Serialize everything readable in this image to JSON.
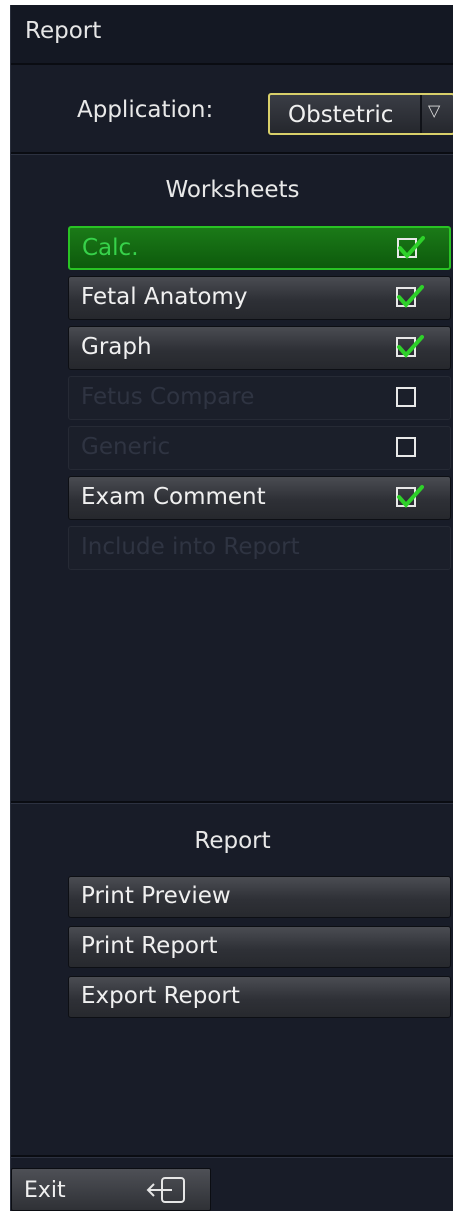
{
  "header": {
    "title": "Report"
  },
  "application": {
    "label": "Application:",
    "selected": "Obstetric",
    "arrow_icon": "chevron-down-icon",
    "accent_color": "#d8cf6a"
  },
  "worksheets": {
    "title": "Worksheets",
    "items": [
      {
        "label": "Calc.",
        "checked": true,
        "state": "active"
      },
      {
        "label": "Fetal Anatomy",
        "checked": true,
        "state": "normal"
      },
      {
        "label": "Graph",
        "checked": true,
        "state": "normal"
      },
      {
        "label": "Fetus Compare",
        "checked": false,
        "state": "disabled"
      },
      {
        "label": "Generic",
        "checked": false,
        "state": "disabled"
      },
      {
        "label": "Exam Comment",
        "checked": true,
        "state": "normal"
      },
      {
        "label": "Include into Report",
        "checked": null,
        "state": "disabled"
      }
    ]
  },
  "report": {
    "title": "Report",
    "buttons": [
      {
        "label": "Print Preview"
      },
      {
        "label": "Print Report"
      },
      {
        "label": "Export Report"
      }
    ]
  },
  "footer": {
    "exit_label": "Exit",
    "exit_icon": "exit-icon"
  },
  "colors": {
    "active_green": "#29c324",
    "checkmark_green": "#2ed12a",
    "panel_bg": "#181c28"
  }
}
